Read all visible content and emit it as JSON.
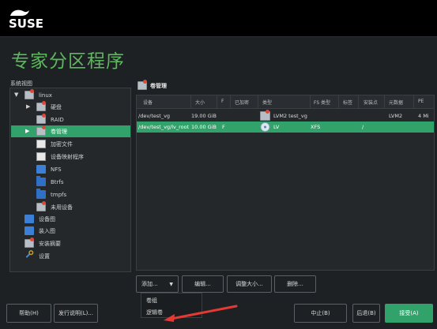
{
  "brand": {
    "logo_text": "SUSE"
  },
  "page": {
    "title": "专家分区程序"
  },
  "tree": {
    "label": "系统视图",
    "items": [
      {
        "label": "linux",
        "icon": "computer-icon"
      },
      {
        "label": "硬盘",
        "icon": "hard-disk-icon"
      },
      {
        "label": "RAID",
        "icon": "raid-icon"
      },
      {
        "label": "卷管理",
        "icon": "volume-icon",
        "selected": true
      },
      {
        "label": "加密文件",
        "icon": "encrypted-file-icon"
      },
      {
        "label": "设备映射程序",
        "icon": "device-mapper-icon"
      },
      {
        "label": "NFS",
        "icon": "nfs-icon"
      },
      {
        "label": "Btrfs",
        "icon": "btrfs-icon"
      },
      {
        "label": "tmpfs",
        "icon": "tmpfs-icon"
      },
      {
        "label": "未用设备",
        "icon": "unused-device-icon"
      },
      {
        "label": "设备图",
        "icon": "device-graph-icon"
      },
      {
        "label": "装入图",
        "icon": "mount-graph-icon"
      },
      {
        "label": "安装摘要",
        "icon": "install-summary-icon"
      },
      {
        "label": "设置",
        "icon": "settings-icon"
      }
    ]
  },
  "volume_manager": {
    "title": "卷管理",
    "columns": [
      "设备",
      "大小",
      "F",
      "已加密",
      "类型",
      "FS 类型",
      "标签",
      "安装点",
      "元数据",
      "PE"
    ],
    "rows": [
      {
        "device": "/dev/test_vg",
        "size": "19.00 GiB",
        "f": "",
        "encrypted": "",
        "type": "LVM2 test_vg",
        "fs_type": "",
        "label": "",
        "mount": "",
        "metadata": "LVM2",
        "pe": "4 Mi"
      },
      {
        "device": "/dev/test_vg/lv_root",
        "size": "10.00 GiB",
        "f": "F",
        "encrypted": "",
        "type": "LV",
        "fs_type": "XFS",
        "label": "",
        "mount": "/",
        "metadata": "",
        "pe": ""
      }
    ]
  },
  "actions": {
    "add": "添加...",
    "edit": "编辑...",
    "resize": "调整大小...",
    "delete": "删除...",
    "add_menu": [
      "卷组",
      "逻辑卷"
    ]
  },
  "footer": {
    "help": "帮助(H)",
    "release_notes": "发行说明(L)...",
    "abort": "中止(B)",
    "back": "后退(B)",
    "accept": "接受(A)"
  },
  "colors": {
    "accent": "#31a36a",
    "title": "#5cb85c",
    "annotation_arrow": "#e53935"
  }
}
